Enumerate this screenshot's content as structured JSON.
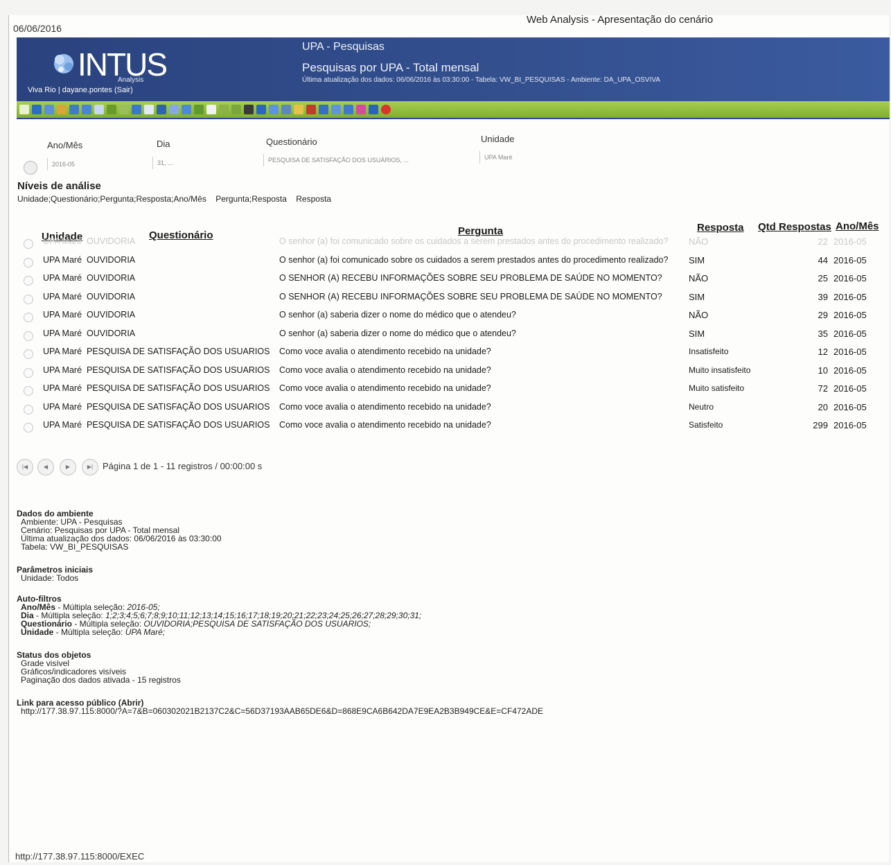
{
  "print": {
    "date": "06/06/2016",
    "title": "Web Analysis - Apresentação do cenário",
    "footer_url": "http://177.38.97.115:8000/EXEC"
  },
  "header": {
    "logo_text": "INTUS",
    "logo_sub": "Analysis",
    "user_line": "Viva Rio | dayane.pontes (Sair)",
    "environment": "UPA - Pesquisas",
    "scenario": "Pesquisas por UPA - Total mensal",
    "update_line": "Última atualização dos dados: 06/06/2016 às 03:30:00 - Tabela: VW_BI_PESQUISAS - Ambiente: DA_UPA_OSVIVA",
    "colors": {
      "band": "#2f4a8a",
      "toolbar": "#8fbd3a",
      "close": "#d9342b"
    }
  },
  "toolbar_icons": [
    "home-icon",
    "refresh-icon",
    "filter-icon",
    "key-icon",
    "grid-icon",
    "grid-edit-icon",
    "level-icon",
    "funnel-icon",
    "tree-icon",
    "chart-icon",
    "table-icon",
    "columns-icon",
    "rows-icon",
    "sum-icon",
    "calc-icon",
    "layout-icon",
    "column-add-icon",
    "column-remove-icon",
    "formula-icon",
    "bar-chart-icon",
    "line-chart-icon",
    "globe-icon",
    "info-icon",
    "pin-icon",
    "save-icon",
    "export-icon",
    "print-icon",
    "share-icon",
    "window-icon",
    "close-icon"
  ],
  "filters": {
    "labels": {
      "ano_mes": "Ano/Mês",
      "dia": "Dia",
      "questionario": "Questionário",
      "unidade": "Unidade"
    },
    "values": {
      "ano_mes": "2016-05",
      "dia": "31, ...",
      "questionario": "PESQUISA DE SATISFAÇÃO DOS USUÁRIOS, ...",
      "unidade": "UPA Maré"
    }
  },
  "levels": {
    "title": "Níveis de análise",
    "items": [
      "Unidade;Questionário;Pergunta;Resposta;Ano/Mês",
      "Pergunta;Resposta",
      "Resposta"
    ]
  },
  "table": {
    "headers": {
      "unidade": "Unidade",
      "questionario": "Questionário",
      "pergunta": "Pergunta",
      "resposta": "Resposta",
      "qtd": "Qtd Respostas",
      "anomes": "Ano/Mês"
    },
    "rows": [
      {
        "unidade": "UPA Maré",
        "questionario": "OUVIDORIA",
        "pergunta": "O senhor (a) foi comunicado sobre os cuidados a serem prestados antes do procedimento realizado?",
        "resposta": "NÃO",
        "qtd": "22",
        "anomes": "2016-05"
      },
      {
        "unidade": "UPA Maré",
        "questionario": "OUVIDORIA",
        "pergunta": "O senhor (a) foi comunicado sobre os cuidados a serem prestados antes do procedimento realizado?",
        "resposta": "SIM",
        "qtd": "44",
        "anomes": "2016-05"
      },
      {
        "unidade": "UPA Maré",
        "questionario": "OUVIDORIA",
        "pergunta": "O SENHOR (A) RECEBU INFORMAÇÕES SOBRE SEU PROBLEMA DE SAÚDE NO MOMENTO?",
        "resposta": "NÃO",
        "qtd": "25",
        "anomes": "2016-05"
      },
      {
        "unidade": "UPA Maré",
        "questionario": "OUVIDORIA",
        "pergunta": "O SENHOR (A) RECEBU INFORMAÇÕES SOBRE SEU PROBLEMA DE SAÚDE NO MOMENTO?",
        "resposta": "SIM",
        "qtd": "39",
        "anomes": "2016-05"
      },
      {
        "unidade": "UPA Maré",
        "questionario": "OUVIDORIA",
        "pergunta": "O senhor (a) saberia dizer o nome do médico que o atendeu?",
        "resposta": "NÃO",
        "qtd": "29",
        "anomes": "2016-05"
      },
      {
        "unidade": "UPA Maré",
        "questionario": "OUVIDORIA",
        "pergunta": "O senhor (a) saberia dizer o nome do médico que o atendeu?",
        "resposta": "SIM",
        "qtd": "35",
        "anomes": "2016-05"
      },
      {
        "unidade": "UPA Maré",
        "questionario": "PESQUISA DE SATISFAÇÃO DOS USUARIOS",
        "pergunta": "Como voce avalia o atendimento recebido na unidade?",
        "resposta": "Insatisfeito",
        "qtd": "12",
        "anomes": "2016-05"
      },
      {
        "unidade": "UPA Maré",
        "questionario": "PESQUISA DE SATISFAÇÃO DOS USUARIOS",
        "pergunta": "Como voce avalia o atendimento recebido na unidade?",
        "resposta": "Muito insatisfeito",
        "qtd": "10",
        "anomes": "2016-05"
      },
      {
        "unidade": "UPA Maré",
        "questionario": "PESQUISA DE SATISFAÇÃO DOS USUARIOS",
        "pergunta": "Como voce avalia o atendimento recebido na unidade?",
        "resposta": "Muito satisfeito",
        "qtd": "72",
        "anomes": "2016-05"
      },
      {
        "unidade": "UPA Maré",
        "questionario": "PESQUISA DE SATISFAÇÃO DOS USUARIOS",
        "pergunta": "Como voce avalia o atendimento recebido na unidade?",
        "resposta": "Neutro",
        "qtd": "20",
        "anomes": "2016-05"
      },
      {
        "unidade": "UPA Maré",
        "questionario": "PESQUISA DE SATISFAÇÃO DOS USUARIOS",
        "pergunta": "Como voce avalia o atendimento recebido na unidade?",
        "resposta": "Satisfeito",
        "qtd": "299",
        "anomes": "2016-05"
      }
    ]
  },
  "pager": {
    "text": "Página 1 de 1 - 11 registros / 00:00:00 s",
    "buttons": [
      "first",
      "prev",
      "next",
      "last"
    ]
  },
  "info": {
    "ambiente": {
      "title": "Dados do ambiente",
      "lines": [
        "Ambiente: UPA - Pesquisas",
        "Cenário: Pesquisas por UPA - Total mensal",
        "Última atualização dos dados: 06/06/2016 às 03:30:00",
        "Tabela: VW_BI_PESQUISAS"
      ]
    },
    "parametros": {
      "title": "Parâmetros iniciais",
      "lines": [
        "Unidade: Todos"
      ]
    },
    "autofiltros": {
      "title": "Auto-filtros",
      "lines": [
        {
          "key": "Ano/Mês",
          "label": " - Múltipla seleção: ",
          "value": "2016-05;"
        },
        {
          "key": "Dia",
          "label": " - Múltipla seleção: ",
          "value": "1;2;3;4;5;6;7;8;9;10;11;12;13;14;15;16;17;18;19;20;21;22;23;24;25;26;27;28;29;30;31;"
        },
        {
          "key": "Questionário",
          "label": " - Múltipla seleção: ",
          "value": "OUVIDORIA;PESQUISA DE SATISFAÇÃO DOS USUARIOS;"
        },
        {
          "key": "Unidade",
          "label": " - Múltipla seleção: ",
          "value": "UPA Maré;"
        }
      ]
    },
    "status": {
      "title": "Status dos objetos",
      "lines": [
        "Grade visível",
        "Gráficos/indicadores visíveis",
        "Paginação dos dados ativada - 15 registros"
      ]
    },
    "link": {
      "title": "Link para acesso público (Abrir)",
      "url": "http://177.38.97.115:8000/?A=7&B=060302021B2137C2&C=56D37193AAB65DE6&D=868E9CA6B642DA7E9EA2B3B949CE&E=CF472ADE"
    }
  }
}
